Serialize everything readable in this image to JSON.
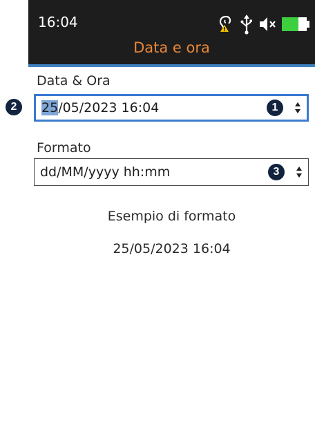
{
  "status_bar": {
    "time": "16:04",
    "icons": [
      "hearing-warning-icon",
      "usb-icon",
      "speaker-muted-icon",
      "battery-icon"
    ]
  },
  "header": {
    "title": "Data e ora"
  },
  "date_time": {
    "label": "Data & Ora",
    "value_selected_part": "25",
    "value_rest": "/05/2023 16:04",
    "badge": "1"
  },
  "left_badge": "2",
  "format": {
    "label": "Formato",
    "value": "dd/MM/yyyy hh:mm",
    "badge": "3"
  },
  "example": {
    "label": "Esempio di formato",
    "value": "25/05/2023 16:04"
  },
  "colors": {
    "topbar": "#1d1d1d",
    "title": "#e8873a",
    "accent": "#3a7ad1",
    "badge": "#12233f",
    "battery": "#3ecf3e"
  }
}
